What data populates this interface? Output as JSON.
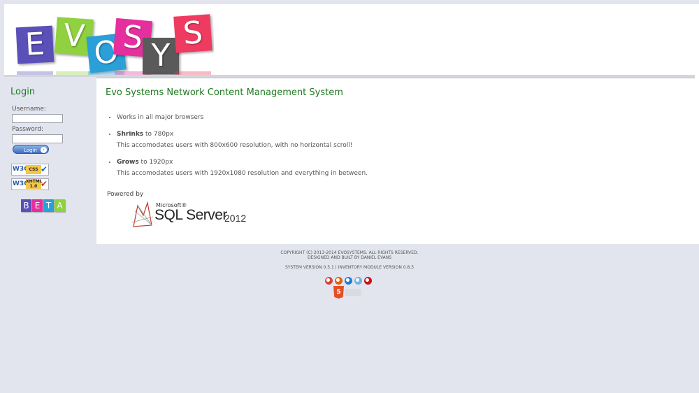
{
  "logo": {
    "letters": [
      "E",
      "V",
      "O",
      "S",
      "Y",
      "S"
    ],
    "colors": [
      "#5b4fb8",
      "#8fd13f",
      "#2a9fd8",
      "#e62f9e",
      "#5a5a5a",
      "#ee3b5f"
    ]
  },
  "sidebar": {
    "login_title": "Login",
    "username_label": "Username:",
    "username_value": "",
    "password_label": "Password:",
    "password_value": "",
    "login_button": "Login",
    "badge_css": {
      "w3c": "W3C",
      "kind": "CSS"
    },
    "badge_xhtml": {
      "w3c": "W3C",
      "kind": "XHTML 1.0"
    },
    "beta": {
      "letters": [
        "B",
        "E",
        "T",
        "A"
      ],
      "colors": [
        "#5b4fb8",
        "#e62f9e",
        "#2a9fd8",
        "#8fd13f"
      ]
    }
  },
  "main": {
    "title": "Evo Systems Network Content Management System",
    "features": [
      {
        "bold": "",
        "text": "Works in all major browsers",
        "sub": ""
      },
      {
        "bold": "Shrinks",
        "text": " to 780px",
        "sub": "This accomodates users with 800x600 resolution, with no horizontal scroll!"
      },
      {
        "bold": "Grows",
        "text": " to 1920px",
        "sub": "This accomodates users with 1920x1080 resolution and everything in between."
      }
    ],
    "powered_label": "Powered by",
    "sql": {
      "ms": "Microsoft®",
      "name": "SQL Server",
      "year": "2012"
    }
  },
  "footer": {
    "copyright": "COPYRIGHT (C) 2013-2014 EVOSYSTEMS. ALL RIGHTS RESERVED.",
    "credit": "DESIGNED AND BUILT BY DANIEL EVANS",
    "version": "SYSTEM VERSION 0.5.1 | INVENTORY MODULE VERSION 0.8.5",
    "browser_icons": [
      "chrome-icon",
      "firefox-icon",
      "ie-icon",
      "safari-icon",
      "opera-icon"
    ],
    "browser_colors": [
      "#db4437",
      "#e66000",
      "#1e7dd8",
      "#6fb3e0",
      "#cc0f16"
    ],
    "html5_label": "5"
  }
}
